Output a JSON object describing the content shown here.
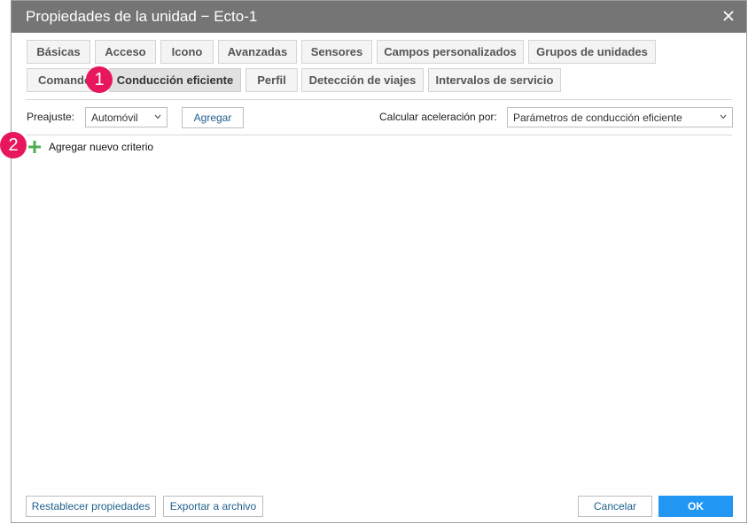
{
  "dialog": {
    "title": "Propiedades de la unidad − Ecto-1",
    "close_icon": "close-icon"
  },
  "tabs_row1": [
    {
      "label": "Básicas"
    },
    {
      "label": "Acceso"
    },
    {
      "label": "Icono"
    },
    {
      "label": "Avanzadas"
    },
    {
      "label": "Sensores"
    },
    {
      "label": "Campos personalizados"
    },
    {
      "label": "Grupos de unidades"
    }
  ],
  "tabs_row2": [
    {
      "label": "Comandos"
    },
    {
      "label": "Conducción eficiente",
      "active": true
    },
    {
      "label": "Perfil"
    },
    {
      "label": "Detección de viajes"
    },
    {
      "label": "Intervalos de servicio"
    }
  ],
  "toolbar": {
    "preset_label": "Preajuste:",
    "preset_value": "Automóvil",
    "add_button": "Agregar",
    "accel_label": "Calcular aceleración por:",
    "accel_value": "Parámetros de conducción eficiente"
  },
  "criteria": {
    "add_label": "Agregar nuevo criterio",
    "icon": "plus-icon"
  },
  "annotations": [
    "1",
    "2"
  ],
  "footer": {
    "reset_button": "Restablecer propiedades",
    "export_button": "Exportar a archivo",
    "cancel_button": "Cancelar",
    "ok_button": "OK"
  },
  "colors": {
    "titlebar": "#757575",
    "accent": "#2196f3",
    "badge": "#e8175d",
    "plus": "#4caf50"
  }
}
